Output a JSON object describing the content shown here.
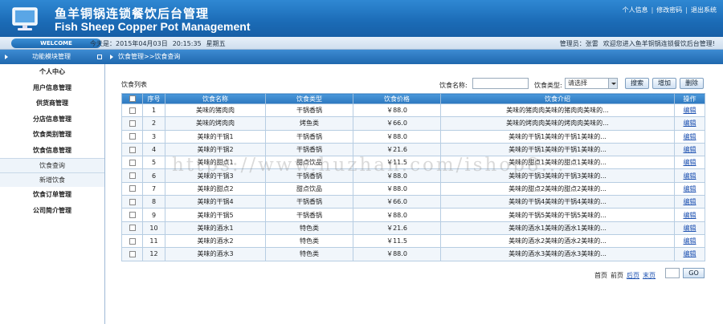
{
  "header": {
    "title_cn": "鱼羊铜锅连锁餐饮后台管理",
    "title_en": "Fish Sheep Copper Pot Management",
    "links": [
      "个人信息",
      "修改密码",
      "退出系统"
    ]
  },
  "infobar": {
    "welcome": "WELCOME",
    "date": "今天是：2015年04月03日",
    "time": "20:15:35",
    "weekday": "星期五",
    "admin": "管理员：张雷",
    "welcome_msg": "欢迎您进入鱼羊铜锅连锁餐饮后台管理!"
  },
  "sidebar": {
    "title": "功能模块管理",
    "items": [
      "个人中心",
      "用户信息管理",
      "供货商管理",
      "分店信息管理",
      "饮食类别管理",
      "饮食信息管理"
    ],
    "subitems": [
      "饮食查询",
      "新增饮食"
    ],
    "items_after": [
      "饮食订单管理",
      "公司简介管理"
    ]
  },
  "main": {
    "breadcrumb": "饮食管理>>饮食查询",
    "list_title": "饮食列表",
    "filter": {
      "name_label": "饮食名称:",
      "type_label": "饮食类型:",
      "type_value": "请选择"
    },
    "buttons": {
      "search": "搜索",
      "add": "增加",
      "delete": "删除"
    },
    "table": {
      "headers": [
        "",
        "序号",
        "饮食名称",
        "饮食类型",
        "饮食价格",
        "饮食介绍",
        "操作"
      ],
      "rows": [
        [
          "1",
          "美味的猪肉肉",
          "干锅香锅",
          "￥88.0",
          "美味的猪肉肉美味的猪肉肉美味的...",
          "编辑"
        ],
        [
          "2",
          "美味的烤肉肉",
          "烤鱼类",
          "￥66.0",
          "美味的烤肉肉美味的烤肉肉美味的...",
          "编辑"
        ],
        [
          "3",
          "美味的干锅1",
          "干锅香锅",
          "￥88.0",
          "美味的干锅1美味的干锅1美味的...",
          "编辑"
        ],
        [
          "4",
          "美味的干锅2",
          "干锅香锅",
          "￥21.6",
          "美味的干锅1美味的干锅1美味的...",
          "编辑"
        ],
        [
          "5",
          "美味的甜点1",
          "甜点饮品",
          "￥11.5",
          "美味的甜点1美味的甜点1美味的...",
          "编辑"
        ],
        [
          "6",
          "美味的干锅3",
          "干锅香锅",
          "￥88.0",
          "美味的干锅3美味的干锅3美味的...",
          "编辑"
        ],
        [
          "7",
          "美味的甜点2",
          "甜点饮品",
          "￥88.0",
          "美味的甜点2美味的甜点2美味的...",
          "编辑"
        ],
        [
          "8",
          "美味的干锅4",
          "干锅香锅",
          "￥66.0",
          "美味的干锅4美味的干锅4美味的...",
          "编辑"
        ],
        [
          "9",
          "美味的干锅5",
          "干锅香锅",
          "￥88.0",
          "美味的干锅5美味的干锅5美味的...",
          "编辑"
        ],
        [
          "10",
          "美味的酒水1",
          "特色类",
          "￥21.6",
          "美味的酒水1美味的酒水1美味的...",
          "编辑"
        ],
        [
          "11",
          "美味的酒水2",
          "特色类",
          "￥11.5",
          "美味的酒水2美味的酒水2美味的...",
          "编辑"
        ],
        [
          "12",
          "美味的酒水3",
          "特色类",
          "￥88.0",
          "美味的酒水3美味的酒水3美味的...",
          "编辑"
        ]
      ]
    },
    "pager": {
      "first": "首页",
      "prev": "前页",
      "next": "后页",
      "last": "末页",
      "go": "GO"
    }
  },
  "watermark": "https://www.huzhan.com/ishop8...",
  "colors": {
    "header_blue": "#1b6bb6",
    "link_blue": "#1a4fb0"
  }
}
